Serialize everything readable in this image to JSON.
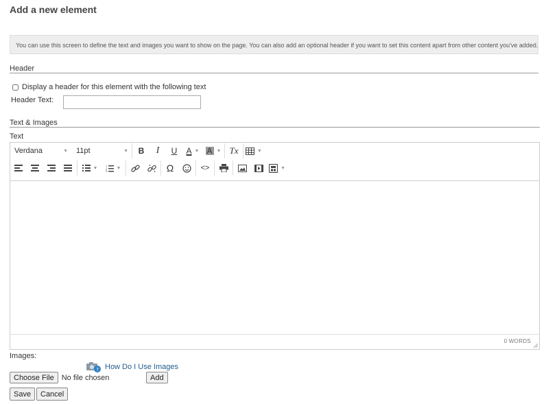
{
  "page": {
    "title": "Add a new element",
    "info": "You can use this screen to define the text and images you want to show on the page. You can also add an optional header if you want to set this content apart from other content you've added."
  },
  "header_section": {
    "title": "Header",
    "checkbox_label": "Display a header for this element with the following text",
    "checkbox_checked": false,
    "text_label": "Header Text:",
    "text_value": ""
  },
  "text_images_section": {
    "title": "Text & Images",
    "text_label": "Text"
  },
  "editor": {
    "font_family": "Verdana",
    "font_size": "11pt",
    "toolbar_row1": [
      "bold-icon",
      "italic-icon",
      "underline-icon",
      "text-color-icon",
      "background-color-icon",
      "clear-formatting-icon",
      "table-icon"
    ],
    "toolbar_row2": [
      "align-left-icon",
      "align-center-icon",
      "align-right-icon",
      "justify-icon",
      "bullet-list-icon",
      "numbered-list-icon",
      "link-icon",
      "unlink-icon",
      "special-character-icon",
      "emoticon-icon",
      "source-code-icon",
      "print-icon",
      "image-icon",
      "media-icon",
      "template-icon"
    ],
    "bold_glyph": "B",
    "italic_glyph": "I",
    "underline_glyph": "U",
    "text_color_glyph": "A",
    "background_color_glyph": "A",
    "clear_format_glyph": "Tx",
    "omega_glyph": "Ω",
    "source_glyph": "<>",
    "content": "",
    "word_count": "0 WORDS"
  },
  "images": {
    "label": "Images:",
    "help_link": "How Do I Use Images",
    "choose_file_label": "Choose File",
    "no_file_text": "No file chosen",
    "add_label": "Add"
  },
  "actions": {
    "save_label": "Save",
    "cancel_label": "Cancel"
  },
  "colors": {
    "info_bg": "#eeeeee",
    "link": "#1f5c8c",
    "border": "#cccccc"
  }
}
